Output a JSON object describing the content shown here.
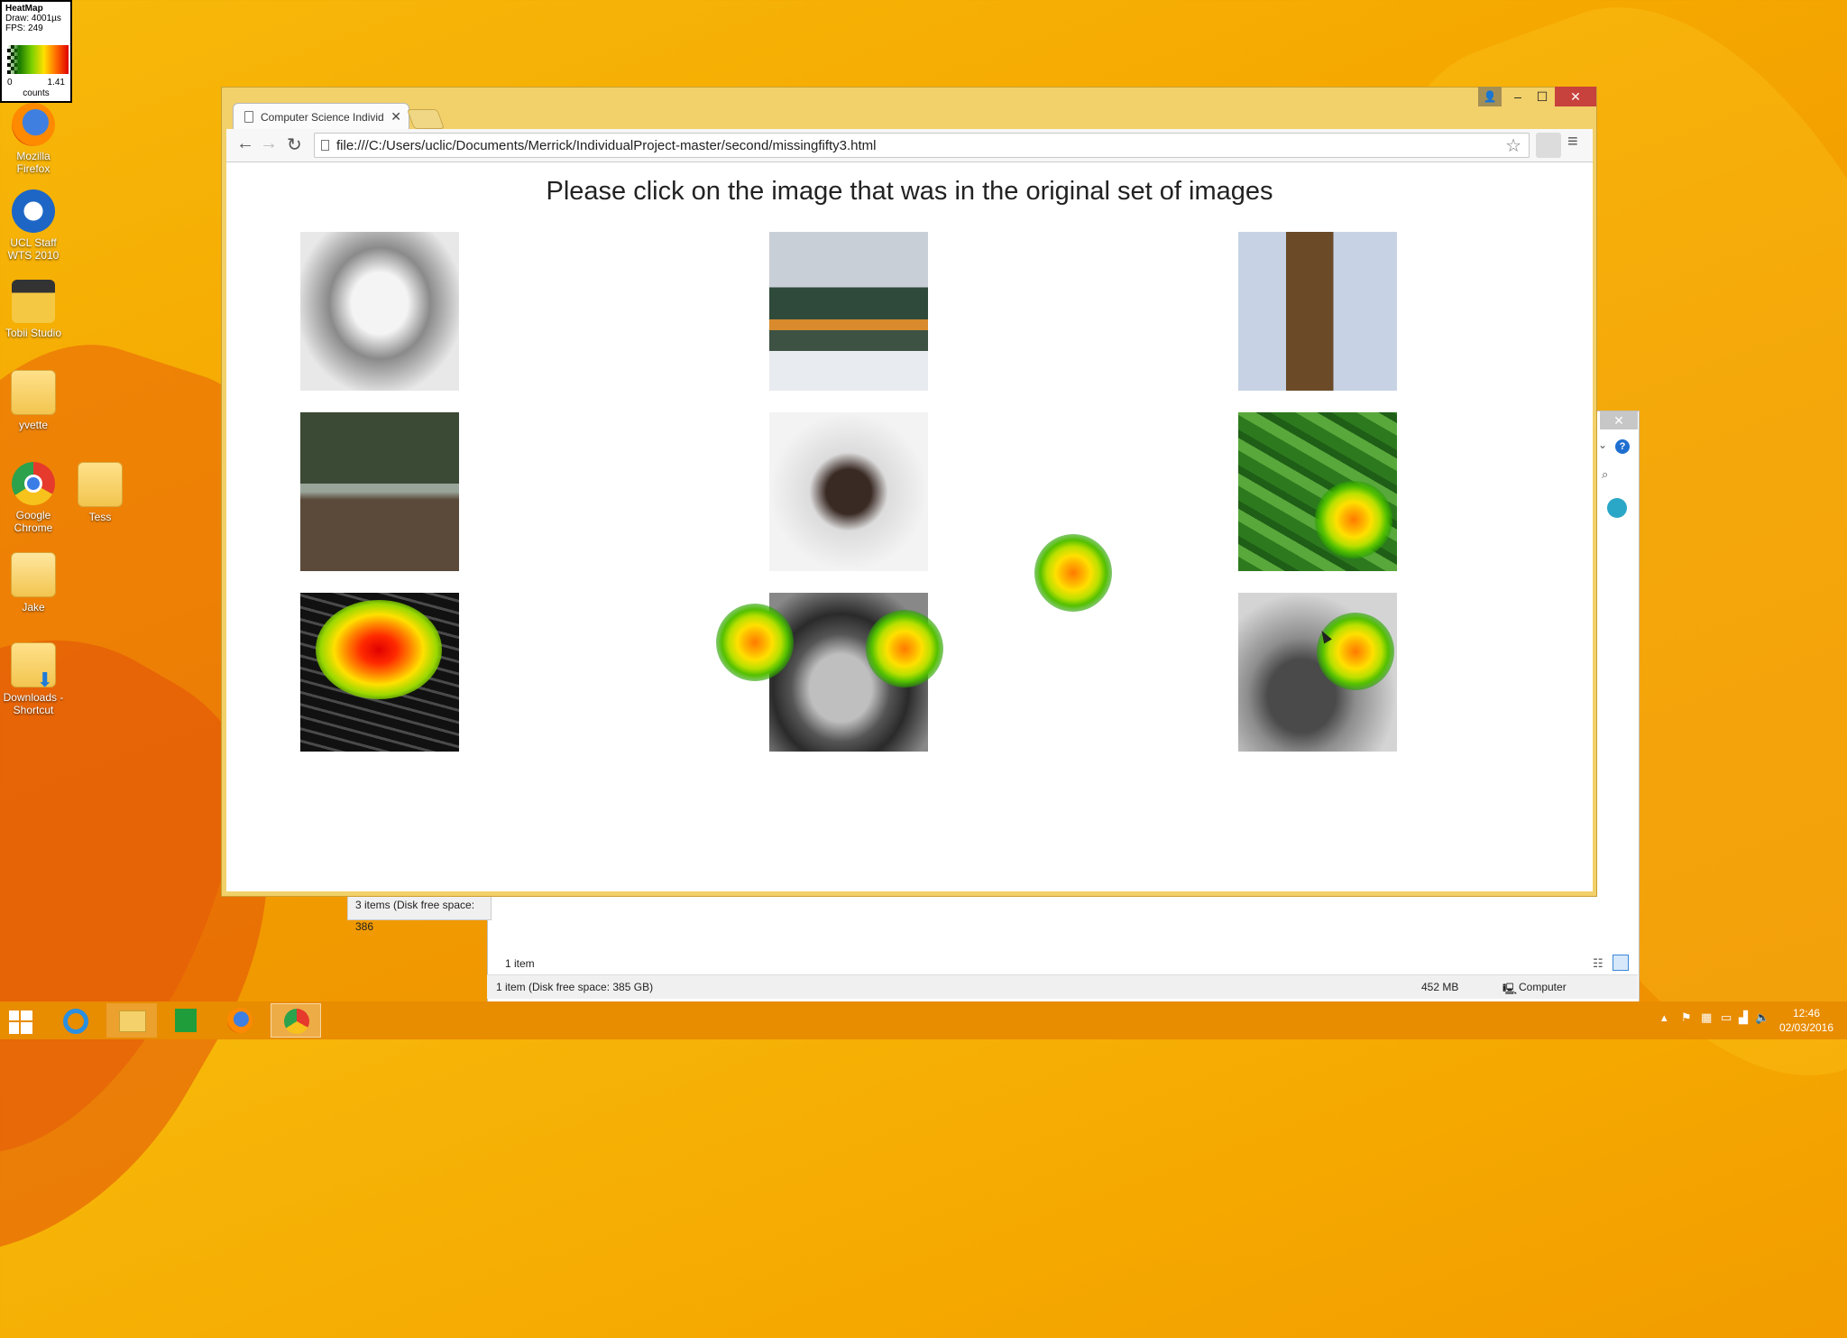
{
  "heatmap_overlay": {
    "title": "HeatMap",
    "draw": "Draw: 4001µs",
    "fps": "FPS: 249",
    "min": "0",
    "max": "1.41",
    "unit": "counts"
  },
  "desktop_icons": [
    {
      "name": "firefox",
      "label_lines": [
        "Mozilla",
        "Firefox"
      ]
    },
    {
      "name": "ucl-staff",
      "label_lines": [
        "UCL Staff",
        "WTS 2010"
      ]
    },
    {
      "name": "tobii-studio",
      "label_lines": [
        "Tobii Studio"
      ]
    },
    {
      "name": "yvette",
      "label_lines": [
        "yvette"
      ]
    },
    {
      "name": "google-chrome",
      "label_lines": [
        "Google",
        "Chrome"
      ]
    },
    {
      "name": "tess",
      "label_lines": [
        "Tess"
      ]
    },
    {
      "name": "jake",
      "label_lines": [
        "Jake"
      ]
    },
    {
      "name": "downloads",
      "label_lines": [
        "Downloads -",
        "Shortcut"
      ]
    }
  ],
  "browser": {
    "tab_title": "Computer Science Individ",
    "url": "file:///C:/Users/uclic/Documents/Merrick/IndividualProject-master/second/missingfifty3.html",
    "page_heading": "Please click on the image that was in the original set of images",
    "images": [
      {
        "name": "sleeping-baby"
      },
      {
        "name": "train"
      },
      {
        "name": "big-ben"
      },
      {
        "name": "headphones-path"
      },
      {
        "name": "woman-fur-hood"
      },
      {
        "name": "cucumbers"
      },
      {
        "name": "keyboard"
      },
      {
        "name": "hotdog-plate"
      },
      {
        "name": "bird"
      }
    ]
  },
  "explorer": {
    "status_left": "1 item (Disk free space: 385 GB)",
    "status_size": "452 MB",
    "status_location": "Computer",
    "items_count": "1 item",
    "small_status": "3 items (Disk free space: 386"
  },
  "taskbar": {
    "time": "12:46",
    "date": "02/03/2016"
  }
}
